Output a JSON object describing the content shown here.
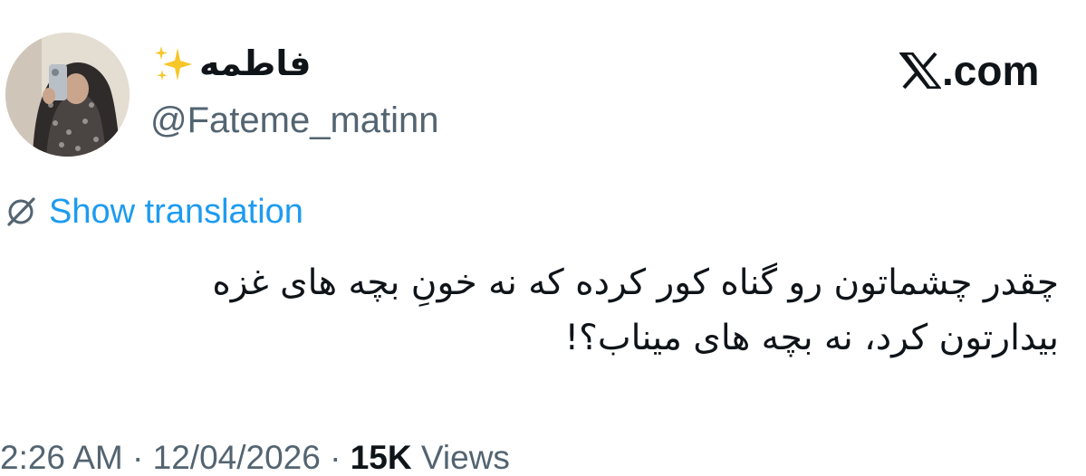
{
  "author": {
    "display_name": "فاطمه",
    "display_emoji": "sparkles-emoji",
    "handle": "@Fateme_matinn",
    "avatar": "profile-photo"
  },
  "brand": {
    "logo_icon": "x-logo-icon",
    "domain_suffix": ".com"
  },
  "translation": {
    "icon": "globe-slash-icon",
    "link_label": "Show translation",
    "link_color": "#1d9bf0"
  },
  "tweet": {
    "lines": [
      "چقدر چشماتون رو گناه کور کرده که نه خونِ بچه های غزه",
      "بیدارتون کرد، نه بچه های میناب؟!"
    ]
  },
  "meta": {
    "time": "2:26 AM",
    "separator": "·",
    "date": "12/04/2026",
    "views_count": "15K",
    "views_label": "Views"
  }
}
